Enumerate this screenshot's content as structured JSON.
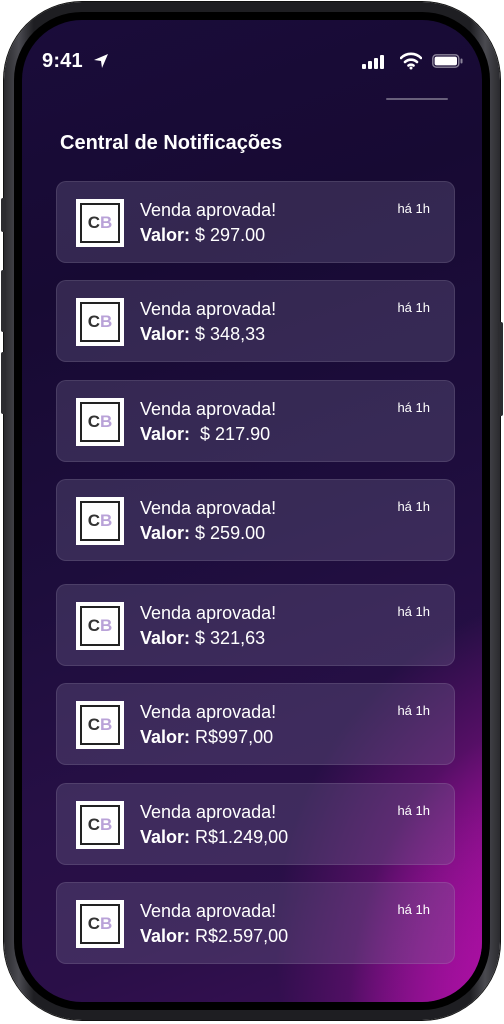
{
  "status_bar": {
    "time": "9:41",
    "icons": [
      "location-arrow-icon",
      "cellular-signal-icon",
      "wifi-icon",
      "battery-icon"
    ]
  },
  "header": {
    "title": "Central de Notificações"
  },
  "logo_text": {
    "c": "C",
    "b": "B"
  },
  "notifications": [
    {
      "title": "Venda aprovada!",
      "value_label": "Valor:",
      "value": " $ 297.00",
      "time": "há 1h"
    },
    {
      "title": "Venda aprovada!",
      "value_label": "Valor:",
      "value": " $ 348,33",
      "time": "há 1h"
    },
    {
      "title": "Venda aprovada!",
      "value_label": "Valor:",
      "value": "  $ 217.90",
      "time": "há 1h"
    },
    {
      "title": "Venda aprovada!",
      "value_label": "Valor:",
      "value": " $ 259.00",
      "time": "há 1h"
    },
    {
      "title": "Venda aprovada!",
      "value_label": "Valor:",
      "value": " $ 321,63",
      "time": "há 1h"
    },
    {
      "title": "Venda aprovada!",
      "value_label": "Valor:",
      "value": " R$997,00",
      "time": "há 1h"
    },
    {
      "title": "Venda aprovada!",
      "value_label": "Valor:",
      "value": " R$1.249,00",
      "time": "há 1h"
    },
    {
      "title": "Venda aprovada!",
      "value_label": "Valor:",
      "value": " R$2.597,00",
      "time": "há 1h"
    }
  ],
  "colors": {
    "background_dark": "#170a33",
    "accent_magenta": "#c20cb8",
    "card_bg": "rgba(120,110,150,0.30)",
    "logo_b": "#b9a2d8"
  }
}
